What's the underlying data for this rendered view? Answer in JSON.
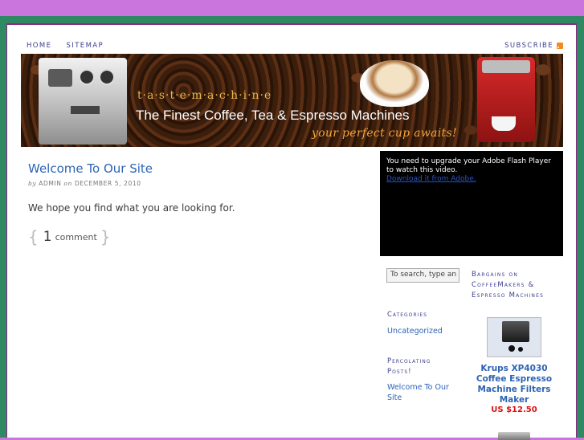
{
  "nav": {
    "home": "HOME",
    "sitemap": "SITEMAP",
    "subscribe": "SUBSCRIBE"
  },
  "header": {
    "brand": "t·a·s·t·e·m·a·c·h·i·n·e",
    "tagline": "The Finest Coffee, Tea & Espresso Machines",
    "slogan": "your perfect cup awaits!"
  },
  "post": {
    "title": "Welcome To Our Site",
    "meta_by": "by",
    "meta_author": "ADMIN",
    "meta_on": "on",
    "meta_date": "DECEMBER 5, 2010",
    "body": "We hope you find what you are looking for.",
    "comment_count": "1",
    "comment_label": "comment",
    "brace_open": "{",
    "brace_close": "}"
  },
  "flash": {
    "message": "You need to upgrade your Adobe Flash Player to watch this video.",
    "link": "Download it from Adobe."
  },
  "sidebar": {
    "search_placeholder": "To search, type an",
    "categories_heading": "Categories",
    "categories": [
      "Uncategorized"
    ],
    "percolating_heading": "Percolating Posts!",
    "posts": [
      "Welcome To Our Site"
    ]
  },
  "bargains": {
    "heading": "Bargains on CoffeeMakers & Espresso Machines",
    "product_name": "Krups XP4030 Coffee Espresso Machine Filters Maker",
    "product_price": "US $12.50"
  },
  "colors": {
    "background": "#c975dd",
    "frame": "#2f8a63",
    "link": "#2d63b4",
    "price": "#dd1111"
  }
}
